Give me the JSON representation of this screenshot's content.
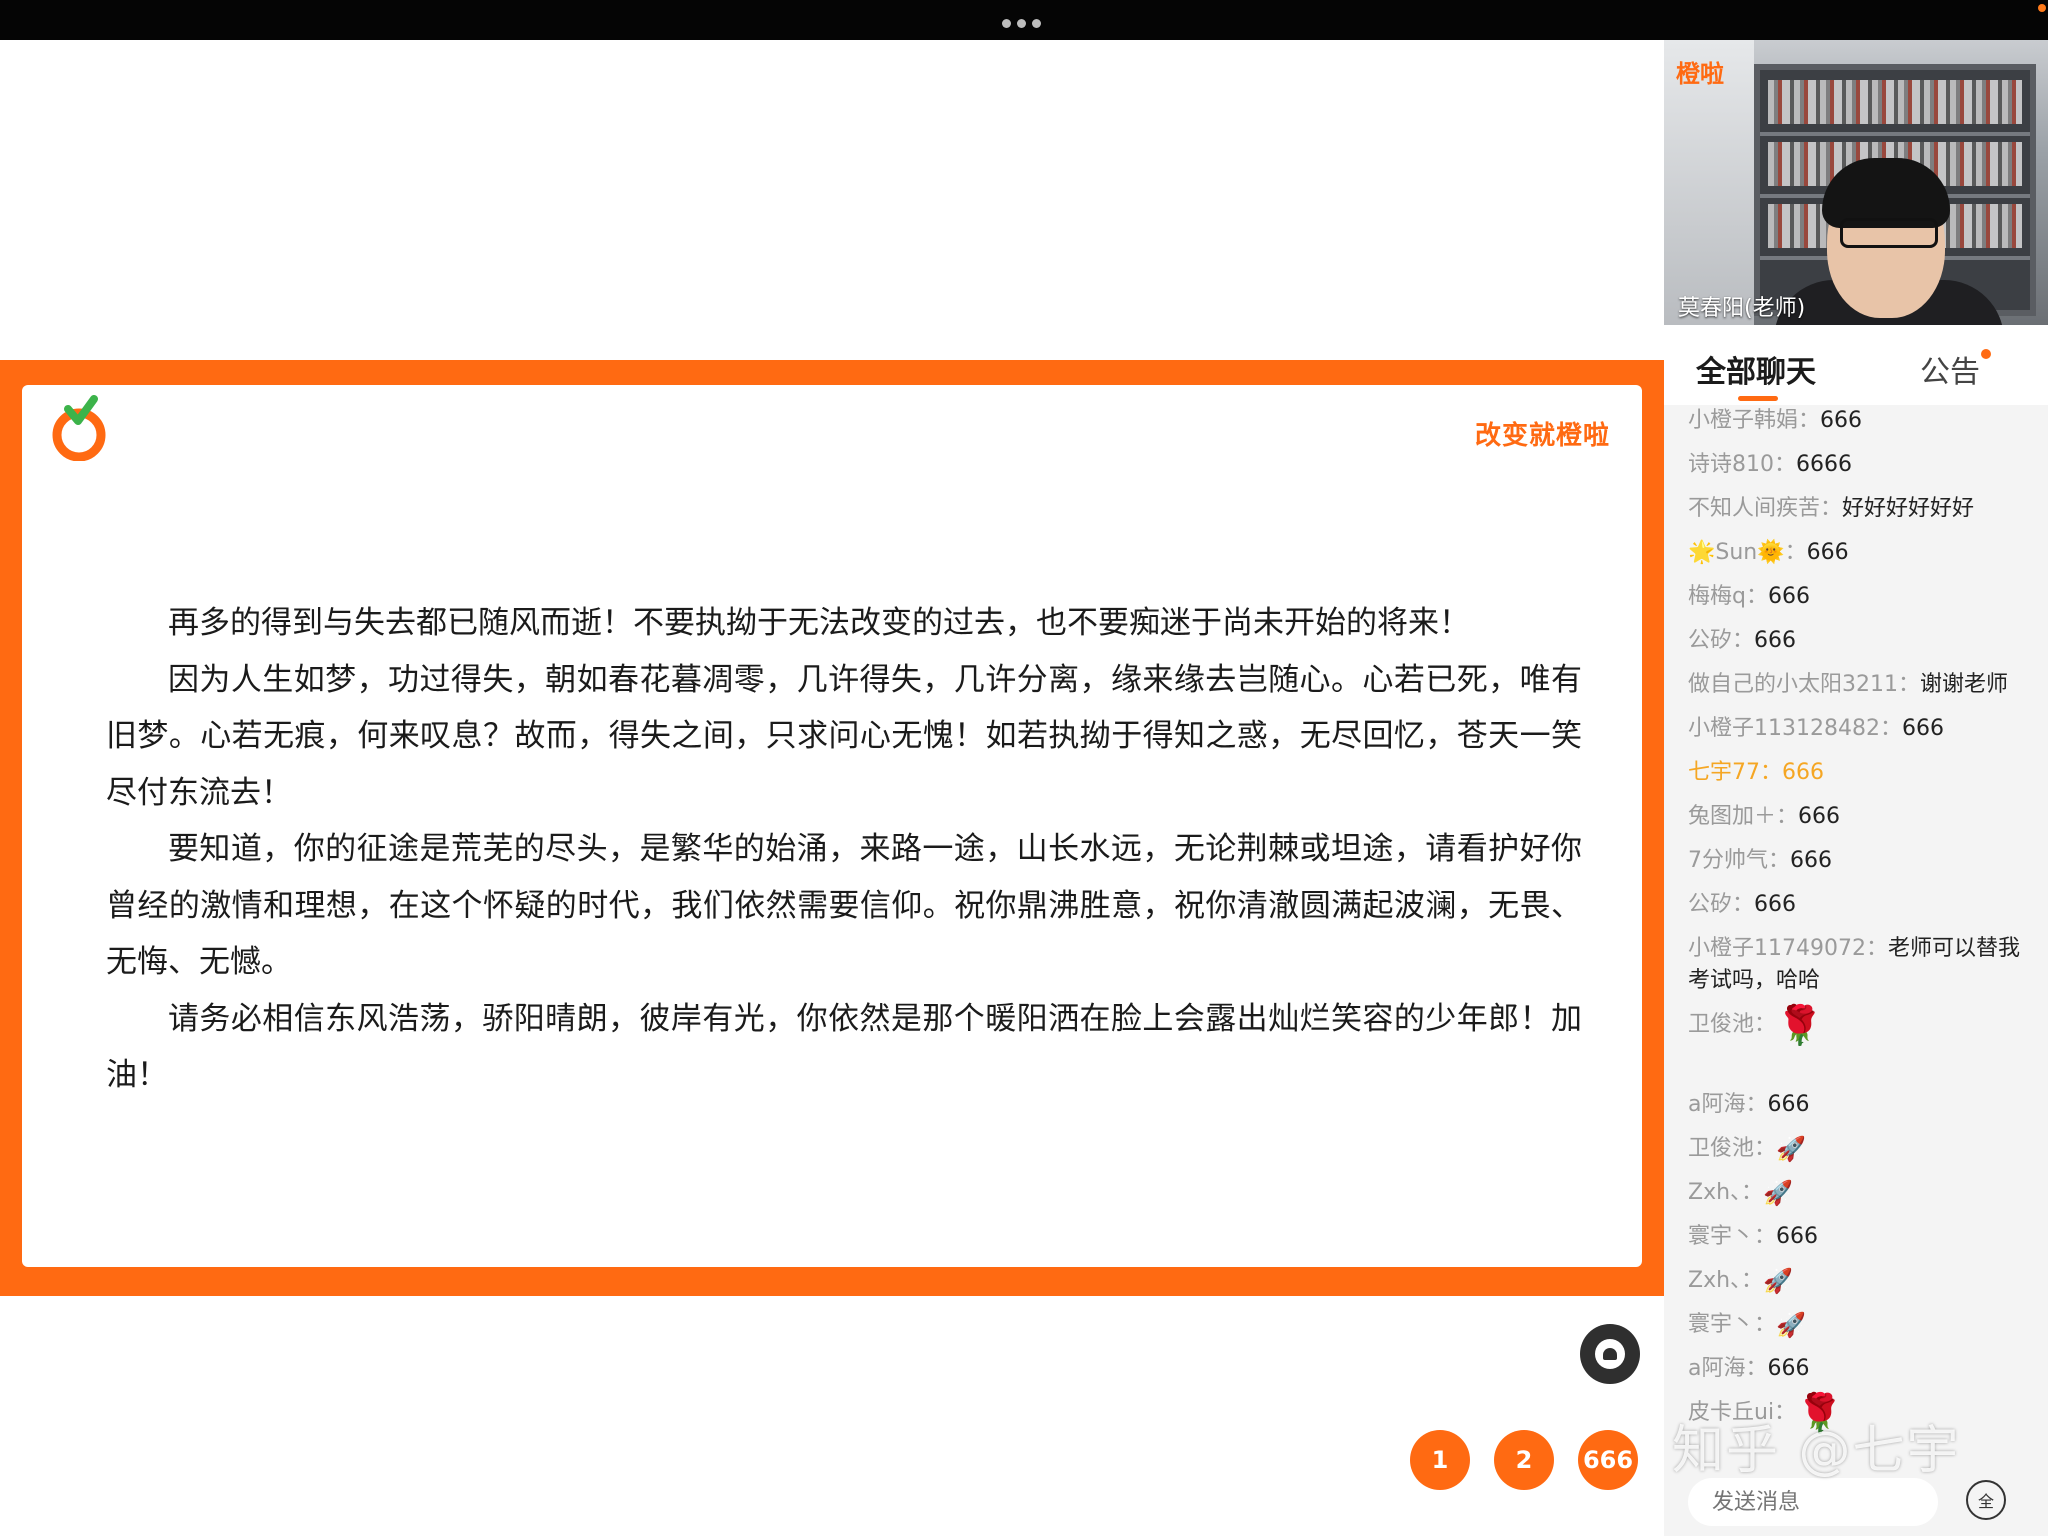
{
  "slide": {
    "tagline": "改变就橙啦",
    "paragraphs": [
      "再多的得到与失去都已随风而逝！不要执拗于无法改变的过去，也不要痴迷于尚未开始的将来！",
      "因为人生如梦，功过得失，朝如春花暮凋零，几许得失，几许分离，缘来缘去岂随心。心若已死，唯有旧梦。心若无痕，何来叹息？故而，得失之间，只求问心无愧！如若执拗于得知之惑，无尽回忆，苍天一笑尽付东流去！",
      "要知道，你的征途是荒芜的尽头，是繁华的始涌，来路一途，山长水远，无论荆棘或坦途，请看护好你曾经的激情和理想，在这个怀疑的时代，我们依然需要信仰。祝你鼎沸胜意，祝你清澈圆满起波澜，无畏、无悔、无憾。",
      "请务必相信东风浩荡，骄阳晴朗，彼岸有光，你依然是那个暖阳洒在脸上会露出灿烂笑容的少年郎！加油！"
    ]
  },
  "quick_replies": [
    "1",
    "2",
    "666"
  ],
  "camera": {
    "logo": "橙啦",
    "name": "莫春阳(老师)"
  },
  "tabs": {
    "active": "全部聊天",
    "other": "公告"
  },
  "chat": [
    {
      "user": "小橙子韩娟：",
      "text": "666"
    },
    {
      "user": "诗诗810：",
      "text": "6666"
    },
    {
      "user": "不知人间疾苦：",
      "text": "好好好好好好"
    },
    {
      "user": "🌟Sun🌞：",
      "text": "666"
    },
    {
      "user": "梅梅q：",
      "text": "666"
    },
    {
      "user": "公矽：",
      "text": "666"
    },
    {
      "user": "做自己的小太阳3211：",
      "text": "谢谢老师"
    },
    {
      "user": "小橙子113128482：",
      "text": "666"
    },
    {
      "user": "七宇77：",
      "text": "666"
    },
    {
      "user": "兔图加＋：",
      "text": "666"
    },
    {
      "user": "7分帅气：",
      "text": "666"
    },
    {
      "user": "公矽：",
      "text": "666"
    },
    {
      "user": "小橙子11749072：",
      "text": "老师可以替我考试吗，哈哈"
    },
    {
      "user": "卫俊池：",
      "text": "🌹"
    },
    {
      "user": "a阿海：",
      "text": "666"
    },
    {
      "user": "卫俊池：",
      "text": "🚀"
    },
    {
      "user": "Zxh、：",
      "text": "🚀"
    },
    {
      "user": "寰宇丶：",
      "text": "666"
    },
    {
      "user": "Zxh、：",
      "text": "🚀"
    },
    {
      "user": "寰宇丶：",
      "text": "🚀"
    },
    {
      "user": "a阿海：",
      "text": "666"
    },
    {
      "user": "皮卡丘ui：",
      "text": "🌹"
    }
  ],
  "watermark": "知乎 @七宇",
  "input": {
    "placeholder": "发送消息",
    "full_label": "全"
  },
  "colors": {
    "accent": "#ff6a12",
    "highlight": "#f5a623"
  }
}
